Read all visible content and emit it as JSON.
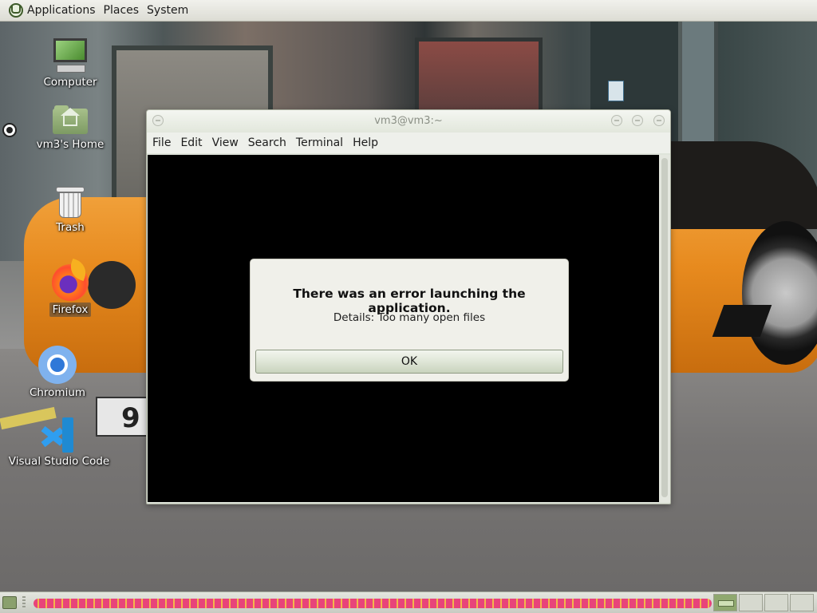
{
  "top_panel": {
    "menus": [
      {
        "label": "Applications"
      },
      {
        "label": "Places"
      },
      {
        "label": "System"
      }
    ]
  },
  "desktop": {
    "icons": [
      {
        "label": "Computer",
        "icon": "computer-icon"
      },
      {
        "label": "vm3's Home",
        "icon": "home-folder-icon"
      },
      {
        "label": "Trash",
        "icon": "trash-icon"
      },
      {
        "label": "Firefox",
        "icon": "firefox-icon"
      },
      {
        "label": "Chromium",
        "icon": "chromium-icon"
      },
      {
        "label": "Visual Studio Code",
        "icon": "vscode-icon"
      }
    ],
    "wallpaper_plate_text": "9"
  },
  "terminal": {
    "title": "vm3@vm3:~",
    "menu": [
      "File",
      "Edit",
      "View",
      "Search",
      "Terminal",
      "Help"
    ]
  },
  "dialog": {
    "message": "There was an error launching the application.",
    "details": "Details: Too many open files",
    "ok_label": "OK"
  },
  "colors": {
    "panel": "#dcdcd4",
    "terminal_bg": "#000000",
    "accent": "#8fa86f"
  }
}
